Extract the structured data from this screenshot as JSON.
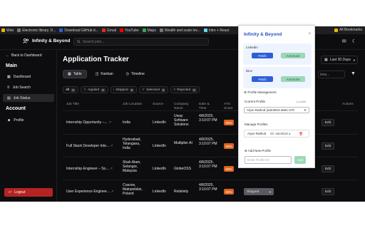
{
  "bookmarks": [
    {
      "label": "Web",
      "color": "#f4b400"
    },
    {
      "label": "Electronic library. D...",
      "color": "#777777"
    },
    {
      "label": "Download GitHub d...",
      "color": "#2d5fd8"
    },
    {
      "label": "Gmail",
      "color": "#d93025"
    },
    {
      "label": "YouTube",
      "color": "#ff0000"
    },
    {
      "label": "Maps",
      "color": "#34a853"
    },
    {
      "label": "Wealth and scale inv...",
      "color": "#777777"
    },
    {
      "label": "Intro + React",
      "color": "#61dafb"
    }
  ],
  "bookmarks_right": "All Bookmarks",
  "app": {
    "name": "Infinity & Beyond",
    "search_placeholder": "Search jobs..."
  },
  "sidebar": {
    "back": "Back to Dashboard",
    "main_title": "Main",
    "items": [
      {
        "label": "Dashboard",
        "icon": "grid-icon"
      },
      {
        "label": "Job Search",
        "icon": "search-icon"
      },
      {
        "label": "Job Status",
        "icon": "document-icon"
      }
    ],
    "account_title": "Account",
    "account_items": [
      {
        "label": "Profile",
        "icon": "user-icon"
      }
    ],
    "logout": "Logout"
  },
  "page": {
    "title": "Application Tracker",
    "views": [
      "Table",
      "Kanban",
      "Timeline"
    ],
    "date_range": "Last 30 Days",
    "search_fragment": "ions..."
  },
  "filters": [
    {
      "label": "All",
      "count": "0"
    },
    {
      "label": "Applied",
      "count": "0"
    },
    {
      "label": "Skipped",
      "count": "0"
    },
    {
      "label": "Selected",
      "count": "0"
    },
    {
      "label": "Rejected",
      "count": "0"
    }
  ],
  "table": {
    "headers": [
      "Job Title",
      "Job Location",
      "Source",
      "Company Name",
      "Date & Time",
      "ATS Score",
      "Actions"
    ],
    "rows": [
      {
        "title": "Internship Opportunity –...",
        "location": "India",
        "source": "LinkedIn",
        "company": "Uway Software Solutions",
        "date": "4/8/2025, 3:10:07 PM",
        "ats": "83%",
        "status": "",
        "action": "Edit"
      },
      {
        "title": "Full Stack Developer Inte...",
        "location": "Hyderabad, Telangana, India",
        "source": "LinkedIn",
        "company": "Multiplier AI",
        "date": "4/8/2025, 3:10:07 PM",
        "ats": "83%",
        "status": "",
        "action": "Edit"
      },
      {
        "title": "Internship-Engineer – So...",
        "location": "Shah Alam, Selangor, Malaysia",
        "source": "LinkedIn",
        "company": "GlobeOSS",
        "date": "4/8/2025, 3:10:07 PM",
        "ats": "83%",
        "status": "",
        "action": "Edit"
      },
      {
        "title": "User Experience Enginee...",
        "location": "Cracow, Małopolskie, Poland",
        "source": "LinkedIn",
        "company": "Relativity",
        "date": "4/8/2025, 3:10:07 PM",
        "ats": "83%",
        "status": "Skipped",
        "action": "Edit"
      }
    ]
  },
  "popup": {
    "title": "Infinity & Beyond",
    "linkedin_label": "Linkedin",
    "linkedin_fetch": "Fetch",
    "linkedin_automate": "Automate",
    "dice_label": "Dice",
    "dice_fetch": "Fetch",
    "dice_automate": "Automate",
    "profile_mgmt": "Profile Management",
    "current_profile_label": "Current Profile",
    "profile_count": "1 profile",
    "current_profile_value": "Arjun Rathod (a3e3818 a681-478",
    "manage_profiles_label": "Manage Profiles",
    "profile_name": "Arjun Rathod",
    "profile_id": "ID: a3e3818 a",
    "add_new_label": "Add New Profile",
    "input_placeholder": "Enter Profile ID",
    "add_button": "Add"
  },
  "colors": {
    "accent_blue": "#2d5fd8",
    "ats_orange": "#e0631b",
    "logout_red": "#b52424",
    "automate_green": "#9bd8b7"
  }
}
